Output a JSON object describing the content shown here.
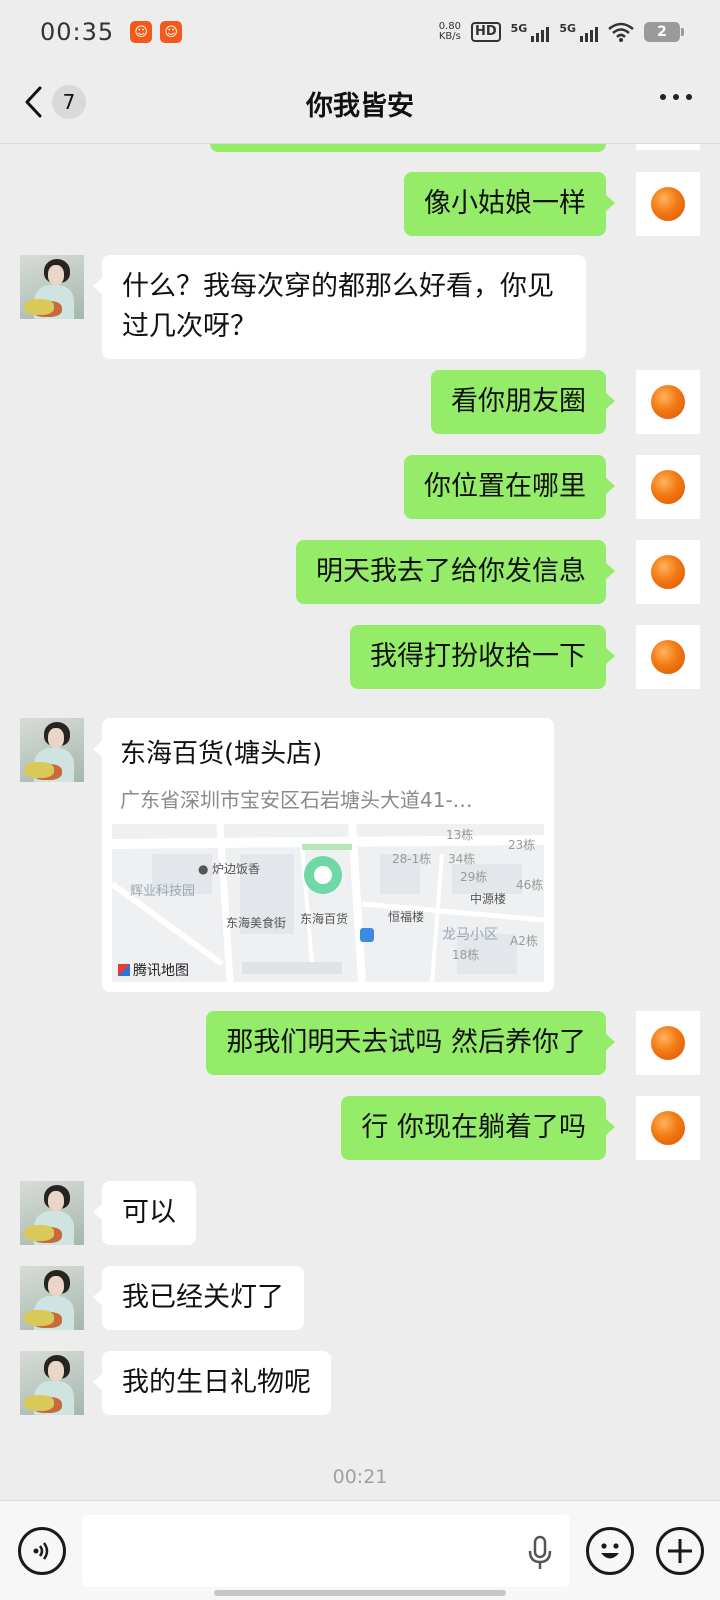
{
  "status_bar": {
    "time": "00:35",
    "net_speed_value": "0.80",
    "net_speed_unit": "KB/s",
    "hd_label": "HD",
    "sim1_label": "5G",
    "sim2_label": "5G",
    "battery": "2"
  },
  "nav": {
    "title": "你我皆安",
    "unread_count": "7"
  },
  "messages": {
    "m0": "像小姑娘一样",
    "m1": "什么？我每次穿的都那么好看，你见过几次呀？",
    "m2": "看你朋友圈",
    "m3": "你位置在哪里",
    "m4": "明天我去了给你发信息",
    "m5": "我得打扮收拾一下",
    "location": {
      "title": "东海百货(塘头店)",
      "address": "广东省深圳市宝安区石岩塘头大道41-…",
      "map_labels": {
        "l1": "炉边饭香",
        "l2": "辉业科技园",
        "l3": "东海美食街",
        "l4": "东海百货",
        "l5": "恒福楼",
        "l6": "中源楼",
        "l7": "龙马小区",
        "l8": "13栋",
        "l9": "28-1栋",
        "l10": "34栋",
        "l11": "23栋",
        "l12": "29栋",
        "l13": "46栋",
        "l14": "18栋",
        "l15": "A2栋",
        "brand": "腾讯地图"
      }
    },
    "m6": "那我们明天去试吗 然后养你了",
    "m7": "行 你现在躺着了吗",
    "m8": "可以",
    "m9": "我已经关灯了",
    "m10": "我的生日礼物呢"
  },
  "timestamp": "00:21",
  "colors": {
    "my_bubble": "#95ec69",
    "their_bubble": "#ffffff",
    "chat_bg": "#ededed"
  },
  "icons": {
    "back": "chevron-left-icon",
    "more": "more-dots-icon",
    "voice": "voice-icon",
    "mic": "mic-icon",
    "emoji": "emoji-icon",
    "plus": "plus-icon"
  }
}
